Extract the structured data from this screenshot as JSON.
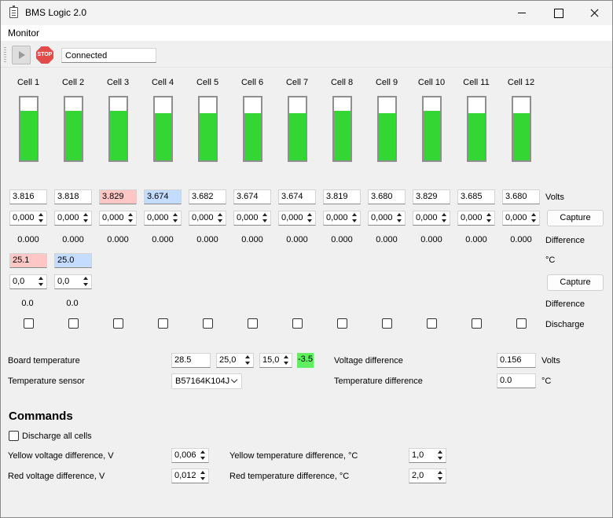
{
  "window": {
    "title": "BMS Logic 2.0"
  },
  "menu": {
    "items": [
      "Monitor"
    ]
  },
  "toolbar": {
    "stop_label": "STOP",
    "status": "Connected"
  },
  "cells": [
    {
      "label": "Cell 1",
      "level": 0.79,
      "voltage": "3.816",
      "voltage_state": "normal",
      "offset": "0,000",
      "difference": "0.000"
    },
    {
      "label": "Cell 2",
      "level": 0.79,
      "voltage": "3.818",
      "voltage_state": "normal",
      "offset": "0,000",
      "difference": "0.000"
    },
    {
      "label": "Cell 3",
      "level": 0.79,
      "voltage": "3.829",
      "voltage_state": "high",
      "offset": "0,000",
      "difference": "0.000"
    },
    {
      "label": "Cell 4",
      "level": 0.75,
      "voltage": "3.674",
      "voltage_state": "low",
      "offset": "0,000",
      "difference": "0.000"
    },
    {
      "label": "Cell 5",
      "level": 0.75,
      "voltage": "3.682",
      "voltage_state": "normal",
      "offset": "0,000",
      "difference": "0.000"
    },
    {
      "label": "Cell 6",
      "level": 0.75,
      "voltage": "3.674",
      "voltage_state": "normal",
      "offset": "0,000",
      "difference": "0.000"
    },
    {
      "label": "Cell 7",
      "level": 0.75,
      "voltage": "3.674",
      "voltage_state": "normal",
      "offset": "0,000",
      "difference": "0.000"
    },
    {
      "label": "Cell 8",
      "level": 0.79,
      "voltage": "3.819",
      "voltage_state": "normal",
      "offset": "0,000",
      "difference": "0.000"
    },
    {
      "label": "Cell 9",
      "level": 0.75,
      "voltage": "3.680",
      "voltage_state": "normal",
      "offset": "0,000",
      "difference": "0.000"
    },
    {
      "label": "Cell 10",
      "level": 0.79,
      "voltage": "3.829",
      "voltage_state": "normal",
      "offset": "0,000",
      "difference": "0.000"
    },
    {
      "label": "Cell 11",
      "level": 0.75,
      "voltage": "3.685",
      "voltage_state": "normal",
      "offset": "0,000",
      "difference": "0.000"
    },
    {
      "label": "Cell 12",
      "level": 0.75,
      "voltage": "3.680",
      "voltage_state": "normal",
      "offset": "0,000",
      "difference": "0.000"
    }
  ],
  "row_labels": {
    "volts": "Volts",
    "difference": "Difference",
    "celsius": "°C",
    "difference2": "Difference",
    "discharge": "Discharge"
  },
  "capture_label": "Capture",
  "temperatures": [
    {
      "value": "25.1",
      "state": "high",
      "offset": "0,0",
      "difference": "0.0"
    },
    {
      "value": "25.0",
      "state": "low",
      "offset": "0,0",
      "difference": "0.0"
    }
  ],
  "board": {
    "temp_label": "Board temperature",
    "temp_value": "28.5",
    "spin1": "25,0",
    "spin2": "15,0",
    "indicator": "-3.5",
    "sensor_label": "Temperature sensor",
    "sensor_value": "B57164K104J",
    "voltage_diff_label": "Voltage difference",
    "voltage_diff_value": "0.156",
    "voltage_diff_unit": "Volts",
    "temp_diff_label": "Temperature difference",
    "temp_diff_value": "0.0",
    "temp_diff_unit": "°C"
  },
  "commands": {
    "title": "Commands",
    "discharge_all": "Discharge all cells",
    "yellow_voltage_label": "Yellow voltage difference, V",
    "yellow_voltage_value": "0,006",
    "red_voltage_label": "Red voltage difference, V",
    "red_voltage_value": "0,012",
    "yellow_temp_label": "Yellow temperature difference, °C",
    "yellow_temp_value": "1,0",
    "red_temp_label": "Red temperature difference, °C",
    "red_temp_value": "2,0"
  }
}
